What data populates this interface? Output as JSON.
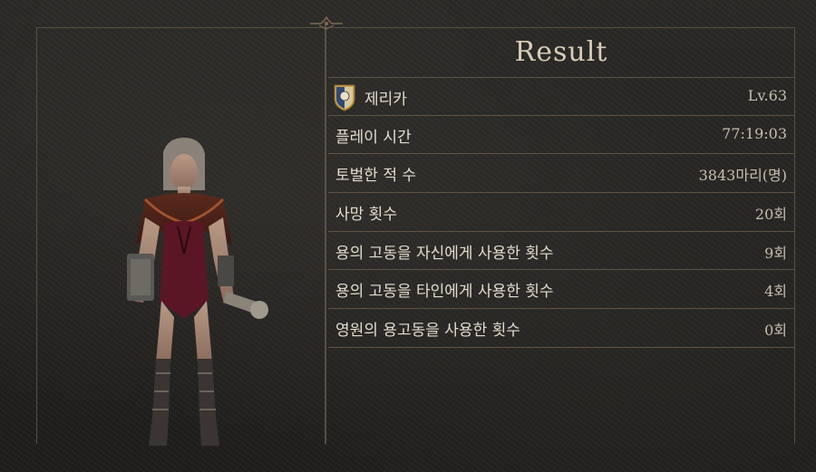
{
  "result": {
    "title": "Result"
  },
  "character": {
    "name": "제리카",
    "level": "Lv.63",
    "emblem_icon": "vocation-shield-emblem-icon"
  },
  "stats": [
    {
      "label": "플레이 시간",
      "value": "77:19:03"
    },
    {
      "label": "토벌한 적 수",
      "value": "3843마리(명)"
    },
    {
      "label": "사망 횟수",
      "value": "20회"
    },
    {
      "label": "용의 고동을 자신에게 사용한 횟수",
      "value": "9회"
    },
    {
      "label": "용의 고동을 타인에게 사용한 횟수",
      "value": "4회"
    },
    {
      "label": "영원의 용고동을 사용한 횟수",
      "value": "0회"
    }
  ],
  "colors": {
    "frame_line": "#6b5e4c",
    "text_primary": "#e2dccf",
    "text_value": "#c8bfae",
    "title": "#d8cdb8",
    "background": "#232220"
  }
}
